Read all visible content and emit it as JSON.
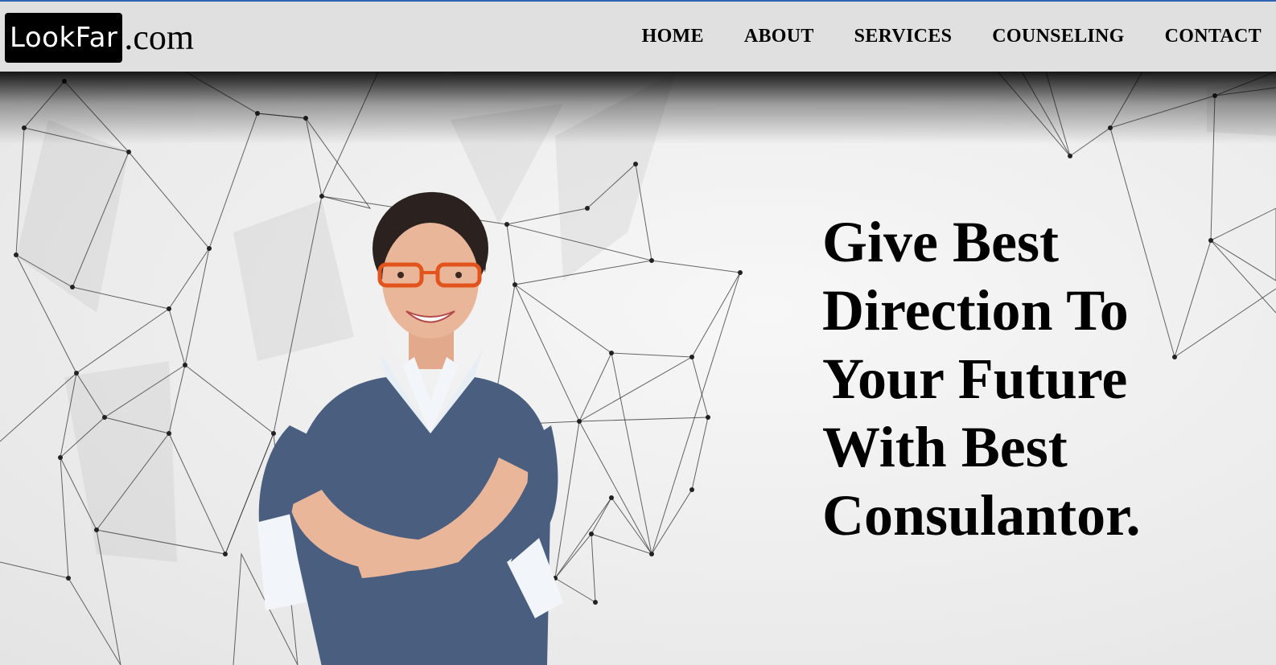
{
  "brand": {
    "logo_box_text": "LookFar",
    "logo_suffix": ".com"
  },
  "nav": {
    "items": [
      "HOME",
      "ABOUT",
      "SERVICES",
      "COUNSELING",
      "CONTACT"
    ]
  },
  "hero": {
    "headline": "Give Best Direction To Your Future With Best Consulantor.",
    "image": "smiling-woman-with-orange-glasses-arms-crossed"
  },
  "colors": {
    "header_bg": "#e0e0e0",
    "top_line": "#2f64b4",
    "logo_bg": "#000000",
    "text": "#000000"
  }
}
